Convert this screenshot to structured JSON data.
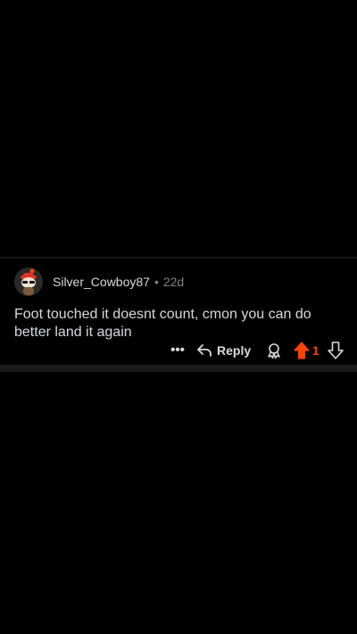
{
  "comment": {
    "username": "Silver_Cowboy87",
    "separator": "•",
    "age": "22d",
    "body": "Foot touched it doesnt count, cmon you can do better land it again",
    "avatar_icon": "snoo-avatar-icon"
  },
  "actions": {
    "more_label": "•••",
    "reply_label": "Reply",
    "vote_count": "1",
    "icons": {
      "more": "more-options-icon",
      "reply": "reply-arrow-icon",
      "award": "award-icon",
      "upvote": "upvote-arrow-icon",
      "downvote": "downvote-arrow-icon"
    }
  },
  "colors": {
    "background": "#000000",
    "text": "#d7dadc",
    "muted": "#818384",
    "upvote_active": "#ff4500",
    "divider": "#1a1a1b"
  }
}
